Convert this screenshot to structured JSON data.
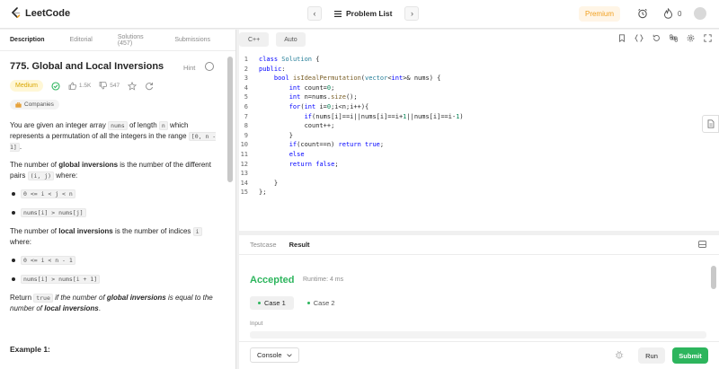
{
  "app": {
    "name": "LeetCode"
  },
  "header": {
    "prev_icon": "‹",
    "next_icon": "›",
    "problem_list_label": "Problem List",
    "premium_label": "Premium",
    "streak_count": "0",
    "colors": {
      "premium_bg": "#fff5e6",
      "premium_text": "#f0a020"
    }
  },
  "left_tabs": [
    "Description",
    "Editorial",
    "Solutions (457)",
    "Submissions"
  ],
  "problem": {
    "title": "775. Global and Local Inversions",
    "hint_label": "Hint",
    "difficulty": "Medium",
    "likes": "1.5K",
    "dislikes": "547",
    "companies_label": "Companies",
    "desc_p1_a": "You are given an integer array ",
    "desc_p1_code1": "nums",
    "desc_p1_b": " of length ",
    "desc_p1_code2": "n",
    "desc_p1_c": " which represents a permutation of all the integers in the range ",
    "desc_p1_code3": "[0, n - 1]",
    "desc_p1_d": ".",
    "desc_p2_a": "The number of ",
    "desc_p2_bold": "global inversions",
    "desc_p2_b": " is the number of the different pairs ",
    "desc_p2_code": "(i, j)",
    "desc_p2_c": " where:",
    "global_conditions": [
      "0 <= i < j < n",
      "nums[i] > nums[j]"
    ],
    "desc_p3_a": "The number of ",
    "desc_p3_bold": "local inversions",
    "desc_p3_b": " is the number of indices ",
    "desc_p3_code": "i",
    "desc_p3_c": " where:",
    "local_conditions": [
      "0 <= i < n - 1",
      "nums[i] > nums[i + 1]"
    ],
    "return_a": "Return ",
    "return_code": "true",
    "return_b": " if the number of ",
    "return_bold1": "global inversions",
    "return_c": " is equal to the number of ",
    "return_bold2": "local inversions",
    "return_d": ".",
    "example_heading": "Example 1:"
  },
  "editor": {
    "language": "C++",
    "auto_label": "Auto",
    "line_numbers": [
      "1",
      "2",
      "3",
      "4",
      "5",
      "6",
      "7",
      "8",
      "9",
      "10",
      "11",
      "12",
      "13",
      "14",
      "15"
    ]
  },
  "result": {
    "tabs": [
      "Testcase",
      "Result"
    ],
    "status": "Accepted",
    "runtime": "Runtime: 4 ms",
    "cases": [
      "Case 1",
      "Case 2"
    ],
    "input_label": "Input",
    "console_label": "Console",
    "run_label": "Run",
    "submit_label": "Submit",
    "colors": {
      "accepted": "#2db55d",
      "submit_bg": "#2db55d"
    }
  }
}
